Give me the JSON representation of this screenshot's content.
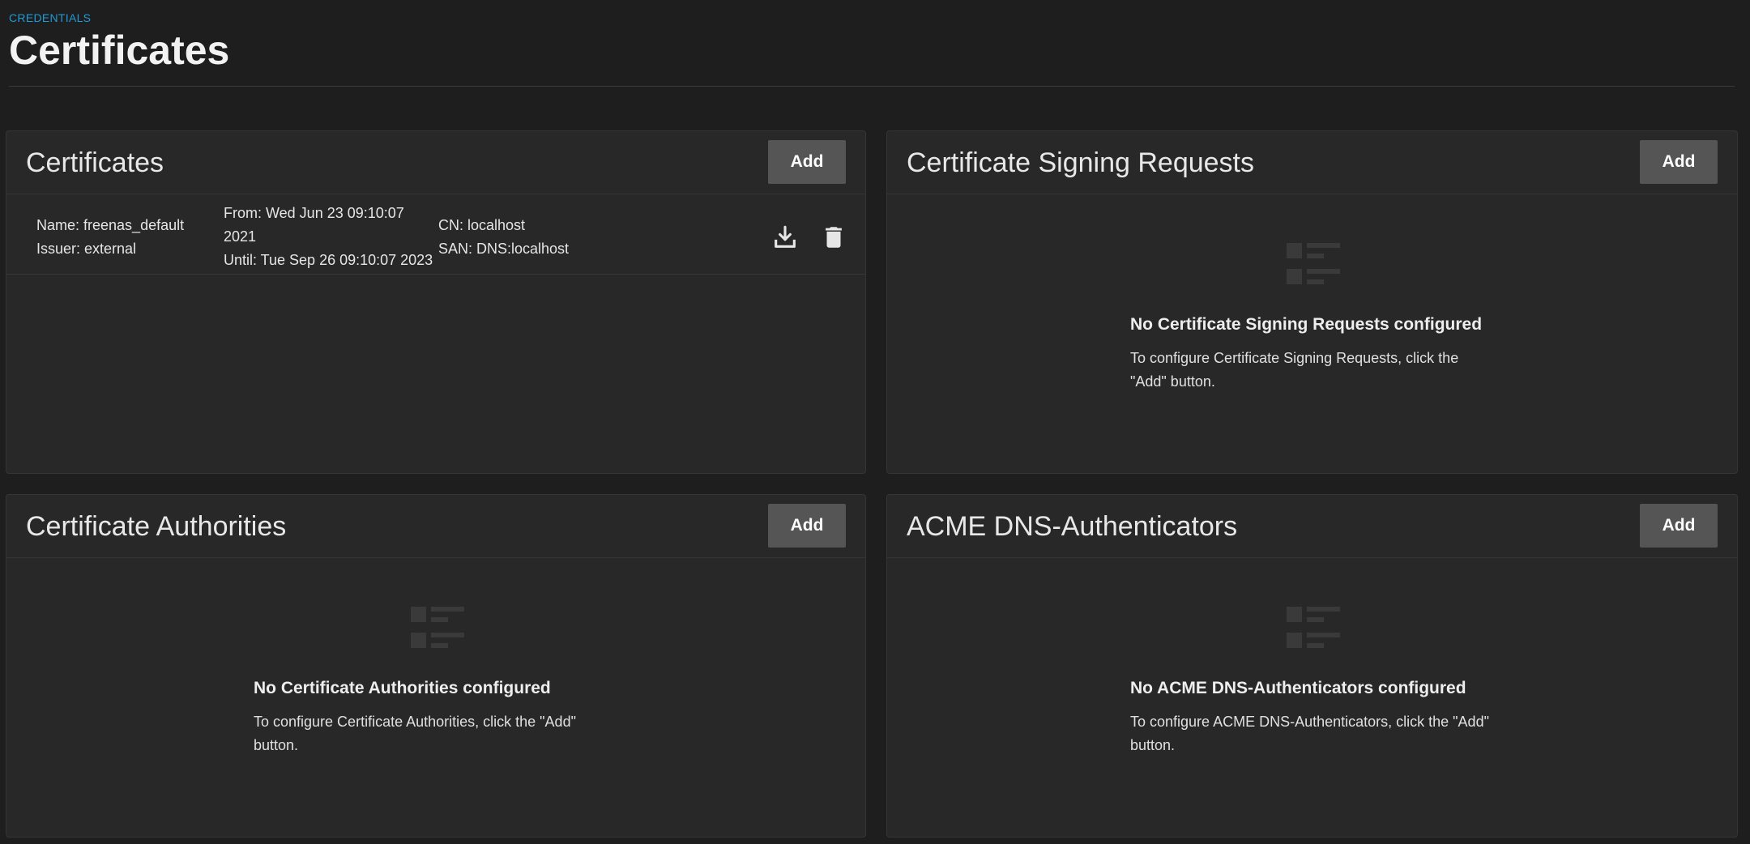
{
  "header": {
    "breadcrumb": "CREDENTIALS",
    "title": "Certificates"
  },
  "cards": {
    "certificates": {
      "title": "Certificates",
      "add_label": "Add",
      "row": {
        "name": "Name: freenas_default",
        "issuer": "Issuer: external",
        "from_line1": "From: Wed Jun 23 09:10:07",
        "from_line2": "2021",
        "until": "Until: Tue Sep 26 09:10:07 2023",
        "cn": "CN: localhost",
        "san": "SAN: DNS:localhost",
        "actions": [
          "download-icon",
          "delete-icon"
        ]
      }
    },
    "csr": {
      "title": "Certificate Signing Requests",
      "add_label": "Add",
      "empty_title": "No Certificate Signing Requests configured",
      "empty_desc_line1": "To configure Certificate Signing Requests, click the",
      "empty_desc_line2": "\"Add\" button."
    },
    "authorities": {
      "title": "Certificate Authorities",
      "add_label": "Add",
      "empty_title": "No Certificate Authorities configured",
      "empty_desc_line1": "To configure Certificate Authorities, click the \"Add\"",
      "empty_desc_line2": "button."
    },
    "acme": {
      "title": "ACME DNS-Authenticators",
      "add_label": "Add",
      "empty_title": "No ACME DNS-Authenticators configured",
      "empty_desc_line1": "To configure ACME DNS-Authenticators, click the \"Add\"",
      "empty_desc_line2": "button."
    }
  },
  "colors": {
    "background": "#1e1e1e",
    "card": "#282828",
    "accent": "#1e9ad6",
    "button": "#555555"
  }
}
